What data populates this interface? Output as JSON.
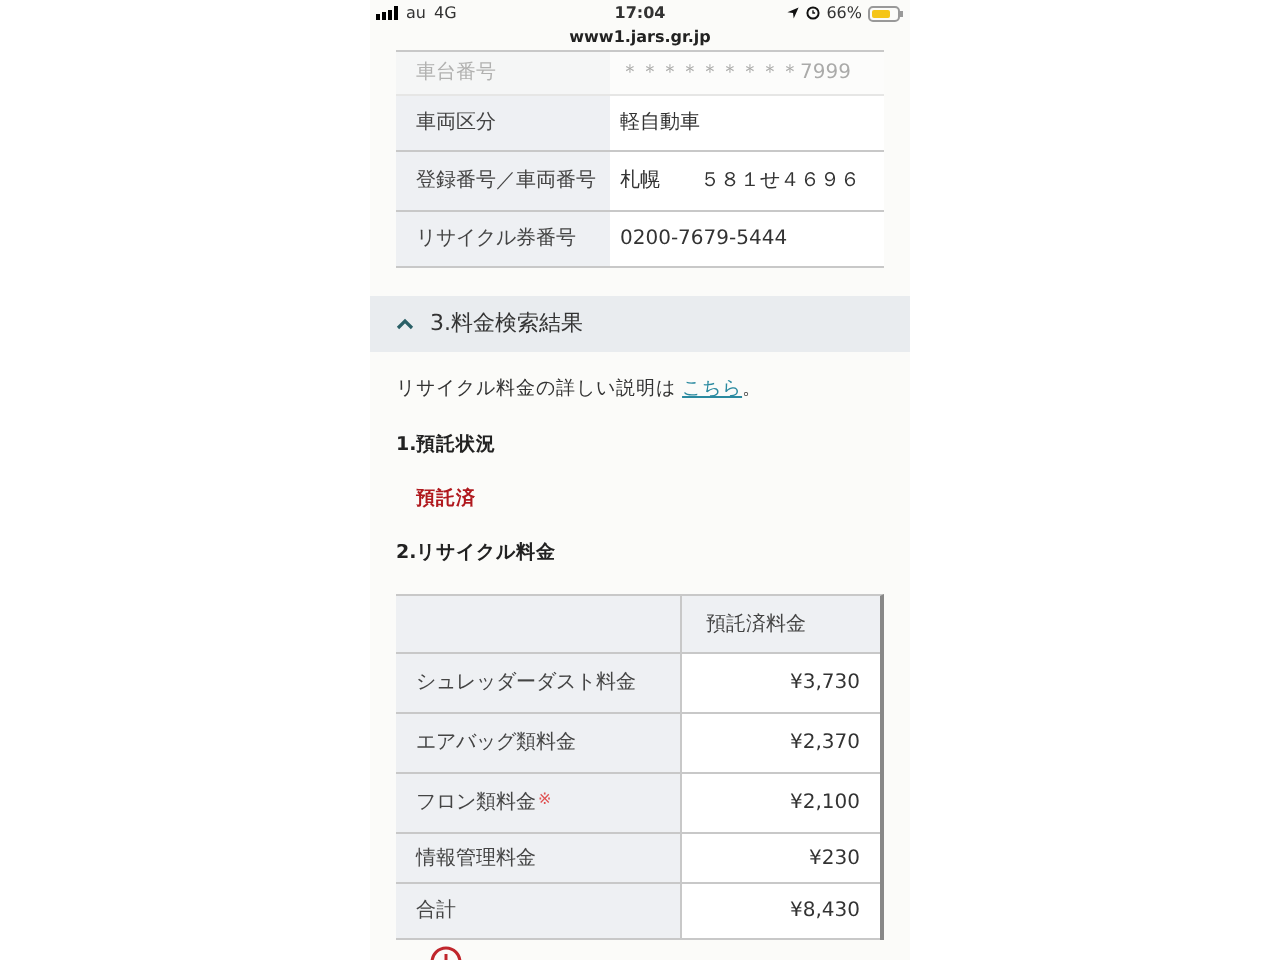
{
  "status_bar": {
    "carrier": "au",
    "network": "4G",
    "time": "17:04",
    "battery": "66%"
  },
  "url": "www1.jars.gr.jp",
  "vehicle_table": [
    {
      "label": "車台番号",
      "value": "＊＊＊＊＊＊＊＊＊7999",
      "faded": true
    },
    {
      "label": "車両区分",
      "value": "軽自動車",
      "faded": false
    },
    {
      "label": "登録番号／車両番号",
      "value": "札幌　　５８１せ４６９６",
      "faded": false
    },
    {
      "label": "リサイクル券番号",
      "value": "0200-7679-5444",
      "faded": false
    }
  ],
  "section": {
    "title": "3.料金検索結果",
    "expanded": true,
    "intro": "リサイクル料金の詳しい説明は",
    "link": "こちら",
    "intro_end": "。",
    "deposit_heading": "1.預託状況",
    "deposit_status": "預託済",
    "fee_heading": "2.リサイクル料金",
    "fee_table": {
      "columns": [
        "預託済料金"
      ],
      "rows": [
        {
          "label": "シュレッダーダスト料金",
          "amount": "¥3,730"
        },
        {
          "label": "エアバッグ類料金",
          "amount": "¥2,370"
        },
        {
          "label": "フロン類料金",
          "note": "※",
          "amount": "¥2,100"
        },
        {
          "label": "情報管理料金",
          "amount": "¥230"
        },
        {
          "label": "合計",
          "amount": "¥8,430"
        }
      ]
    }
  }
}
